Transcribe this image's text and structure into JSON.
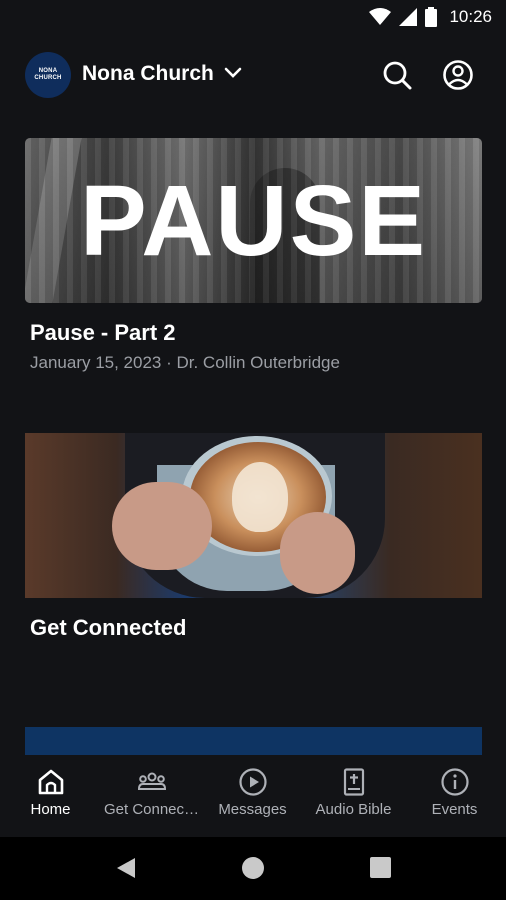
{
  "status_bar": {
    "time": "10:26",
    "icons": [
      "wifi-icon",
      "signal-icon",
      "battery-icon"
    ]
  },
  "header": {
    "logo_lines": [
      "NONA",
      "CHURCH"
    ],
    "church_name": "Nona Church",
    "icons": [
      "chevron-down-icon",
      "search-icon",
      "account-icon"
    ]
  },
  "feed": [
    {
      "image_text": "PAUSE",
      "title": "Pause - Part 2",
      "meta": "January 15, 2023 · Dr. Collin Outerbridge"
    },
    {
      "title": "Get Connected"
    }
  ],
  "bottom_nav": [
    {
      "label": "Home",
      "icon": "home-icon",
      "active": true
    },
    {
      "label": "Get Connec…",
      "icon": "group-icon",
      "active": false
    },
    {
      "label": "Messages",
      "icon": "play-circle-icon",
      "active": false
    },
    {
      "label": "Audio Bible",
      "icon": "bible-icon",
      "active": false
    },
    {
      "label": "Events",
      "icon": "info-icon",
      "active": false
    }
  ],
  "colors": {
    "background": "#121316",
    "brand": "#0e3463",
    "muted_text": "#9b9ea4"
  },
  "system_nav": [
    "back-icon",
    "home-circle-icon",
    "recents-icon"
  ]
}
